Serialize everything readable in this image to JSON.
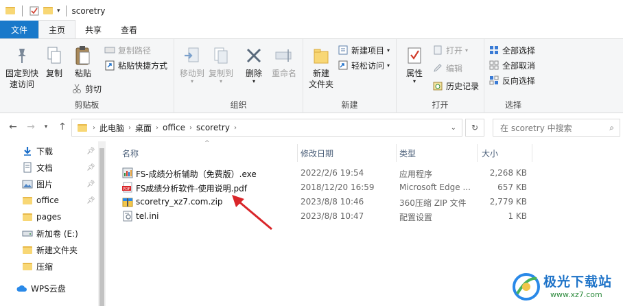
{
  "window": {
    "title": "scoretry"
  },
  "tabs": [
    {
      "label": "文件"
    },
    {
      "label": "主页"
    },
    {
      "label": "共享"
    },
    {
      "label": "查看"
    }
  ],
  "ribbon": {
    "clipboard": {
      "label": "剪贴板",
      "pin_quick": "固定到快\n速访问",
      "pin_line1": "固定到快",
      "pin_line2": "速访问",
      "copy": "复制",
      "paste": "粘贴",
      "copy_path": "复制路径",
      "paste_shortcut": "粘贴快捷方式",
      "cut": "剪切"
    },
    "organize": {
      "label": "组织",
      "move_to": "移动到",
      "copy_to": "复制到",
      "delete": "删除",
      "rename": "重命名"
    },
    "new": {
      "label": "新建",
      "new_folder_line1": "新建",
      "new_folder_line2": "文件夹",
      "new_item": "新建项目",
      "easy_access": "轻松访问"
    },
    "open": {
      "label": "打开",
      "properties": "属性",
      "open": "打开",
      "edit": "编辑",
      "history": "历史记录"
    },
    "select": {
      "label": "选择",
      "select_all": "全部选择",
      "select_none": "全部取消",
      "invert": "反向选择"
    }
  },
  "address": {
    "crumbs": [
      "此电脑",
      "桌面",
      "office",
      "scoretry"
    ],
    "search_placeholder": "在 scoretry 中搜索"
  },
  "nav_pane": [
    {
      "label": "下载",
      "icon": "download-icon",
      "pinned": true
    },
    {
      "label": "文档",
      "icon": "document-icon",
      "pinned": true
    },
    {
      "label": "图片",
      "icon": "picture-icon",
      "pinned": true
    },
    {
      "label": "office",
      "icon": "folder-icon",
      "pinned": true
    },
    {
      "label": "pages",
      "icon": "folder-icon",
      "pinned": false
    },
    {
      "label": "新加卷 (E:)",
      "icon": "drive-icon",
      "pinned": false
    },
    {
      "label": "新建文件夹",
      "icon": "folder-icon",
      "pinned": false
    },
    {
      "label": "压缩",
      "icon": "folder-icon",
      "pinned": false
    },
    {
      "label": "WPS云盘",
      "icon": "cloud-icon",
      "pinned": false
    }
  ],
  "columns": {
    "name": "名称",
    "date": "修改日期",
    "type": "类型",
    "size": "大小"
  },
  "files": [
    {
      "name": "FS-成绩分析辅助（免费版）.exe",
      "date": "2022/2/6 19:54",
      "type": "应用程序",
      "size": "2,268 KB",
      "icon": "exe-icon"
    },
    {
      "name": "FS成绩分析软件-使用说明.pdf",
      "date": "2018/12/20 16:59",
      "type": "Microsoft Edge ...",
      "size": "657 KB",
      "icon": "pdf-icon"
    },
    {
      "name": "scoretry_xz7.com.zip",
      "date": "2023/8/8 10:46",
      "type": "360压缩 ZIP 文件",
      "size": "2,779 KB",
      "icon": "zip-icon"
    },
    {
      "name": "tel.ini",
      "date": "2023/8/8 10:47",
      "type": "配置设置",
      "size": "1 KB",
      "icon": "ini-icon"
    }
  ],
  "watermark": {
    "text": "极光下载站",
    "url": "www.xz7.com"
  },
  "colors": {
    "file_tab": "#1979ca",
    "ribbon_bg": "#f5f6f7",
    "folder": "#f8d775",
    "arrow": "#d9262a"
  }
}
